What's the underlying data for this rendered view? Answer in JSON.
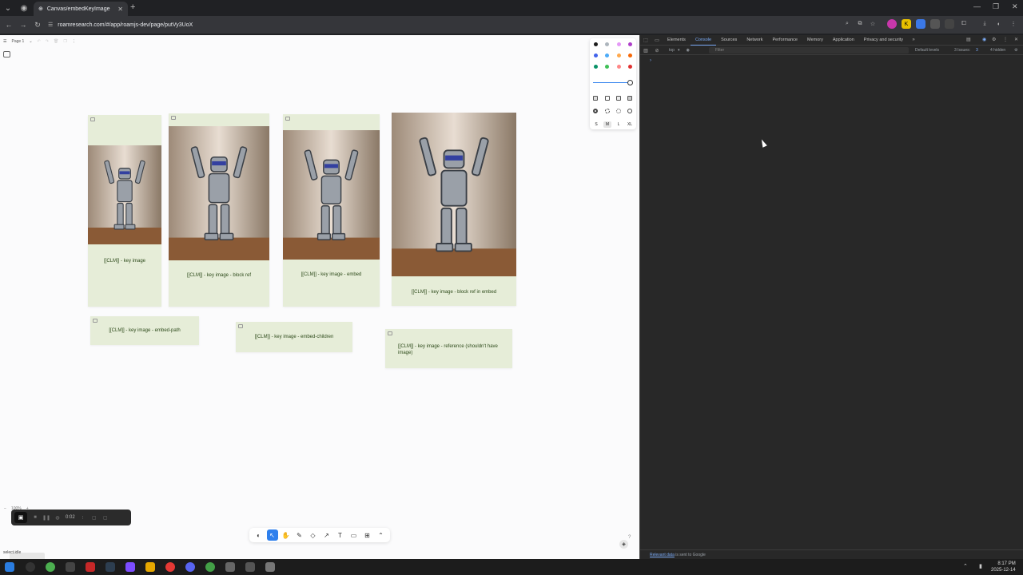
{
  "browser": {
    "tab_title": "Canvas/embedKeyImage",
    "url": "roamresearch.com/#/app/roamjs-dev/page/putVy3UoX"
  },
  "canvas": {
    "page_label": "Page 1",
    "status": "select.idle",
    "zoom": "100%",
    "cards": [
      {
        "label": "[[CLM]] - key image"
      },
      {
        "label": "[[CLM]] - key image - block ref"
      },
      {
        "label": "[[CLM]] - key image - embed"
      },
      {
        "label": "[[CLM]] - key image - block ref in embed"
      },
      {
        "label": "[[CLM]] - key image - embed-path"
      },
      {
        "label": "[[CLM]] - key image - embed-children"
      },
      {
        "label": "[[CLM]] - key image - reference (shouldn't have image)"
      }
    ],
    "style_panel": {
      "colors": [
        "#1d1d1d",
        "#adb5bd",
        "#e599f7",
        "#ae3ec9",
        "#4263eb",
        "#4dabf7",
        "#ffa94d",
        "#f76707",
        "#099268",
        "#40c057",
        "#ff8787",
        "#e03131"
      ],
      "sizes": [
        "S",
        "M",
        "L",
        "XL"
      ],
      "selected_size": "M"
    },
    "tools": [
      "eye-icon",
      "select-icon",
      "hand-icon",
      "pencil-icon",
      "eraser-icon",
      "arrow-icon",
      "text-icon",
      "note-icon",
      "frame-icon",
      "chevron-up-icon"
    ],
    "recorder_time": "0:02"
  },
  "devtools": {
    "tabs": [
      "Elements",
      "Console",
      "Sources",
      "Network",
      "Performance",
      "Memory",
      "Application",
      "Privacy and security"
    ],
    "active_tab": "Console",
    "context": "top",
    "filter_placeholder": "Filter",
    "levels": "Default levels",
    "issues": "3 Issues:",
    "issues_count": "3",
    "hidden": "4 hidden",
    "footer_link": "Relevant data",
    "footer_rest": " is sent to Google"
  },
  "taskbar": {
    "time": "8:17 PM",
    "date": "2025-12-14"
  }
}
